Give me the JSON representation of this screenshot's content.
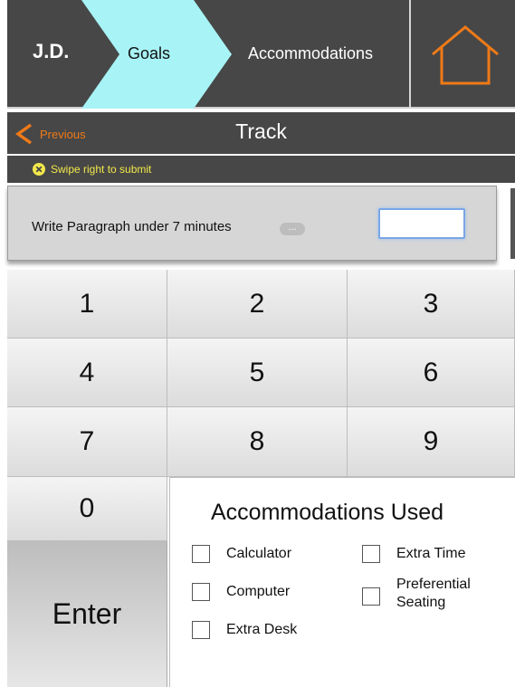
{
  "header": {
    "initials": "J.D.",
    "goals_label": "Goals",
    "accommodations_label": "Accommodations",
    "home_icon": "home-icon",
    "goals_color": "#a8f3f5",
    "home_color": "#f07a18"
  },
  "trackbar": {
    "previous_label": "Previous",
    "title": "Track"
  },
  "hint": {
    "text": "Swipe right to submit",
    "icon": "close-circle-icon"
  },
  "goal": {
    "text": "Write Paragraph under 7 minutes",
    "more_label": "...",
    "score_value": ""
  },
  "keypad": {
    "keys": [
      "1",
      "2",
      "3",
      "4",
      "5",
      "6",
      "7",
      "8",
      "9",
      "0"
    ],
    "enter_label": "Enter"
  },
  "accommodations": {
    "title": "Accommodations Used",
    "options": [
      "Calculator",
      "Extra Time",
      "Computer",
      "Preferential Seating",
      "Extra Desk"
    ]
  }
}
